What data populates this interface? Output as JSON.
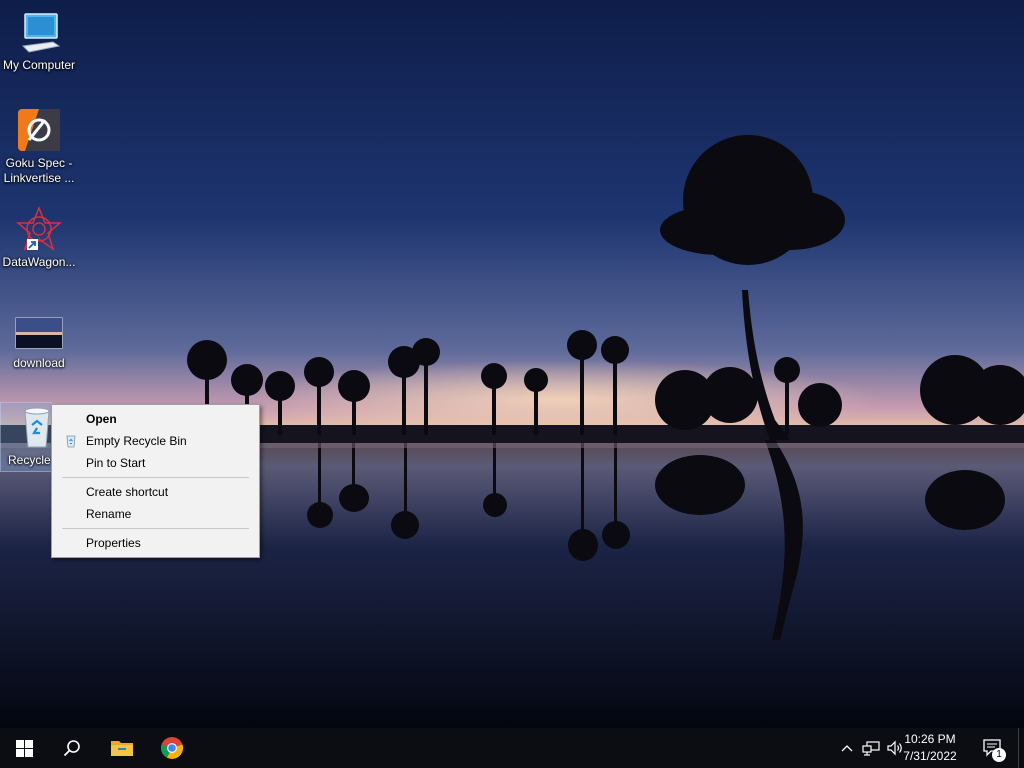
{
  "desktop": {
    "icons": [
      {
        "label": "My Computer"
      },
      {
        "label": "Goku Spec - Linkvertise ..."
      },
      {
        "label": "DataWagon..."
      },
      {
        "label": "download"
      },
      {
        "label": "Recycle"
      }
    ]
  },
  "context_menu": {
    "items": [
      {
        "label": "Open"
      },
      {
        "label": "Empty Recycle Bin"
      },
      {
        "label": "Pin to Start"
      },
      {
        "label": "Create shortcut"
      },
      {
        "label": "Rename"
      },
      {
        "label": "Properties"
      }
    ]
  },
  "taskbar": {
    "start_icon": "windows-logo-icon",
    "search_icon": "search-icon",
    "pinned": [
      "file-explorer-icon",
      "chrome-icon"
    ],
    "clock": {
      "time": "10:26 PM",
      "date": "7/31/2022"
    },
    "notification_count": "1"
  },
  "colors": {
    "taskbar": "#0b0d12",
    "menu_bg": "#f2f2f2",
    "selection": "#78a0d2"
  }
}
